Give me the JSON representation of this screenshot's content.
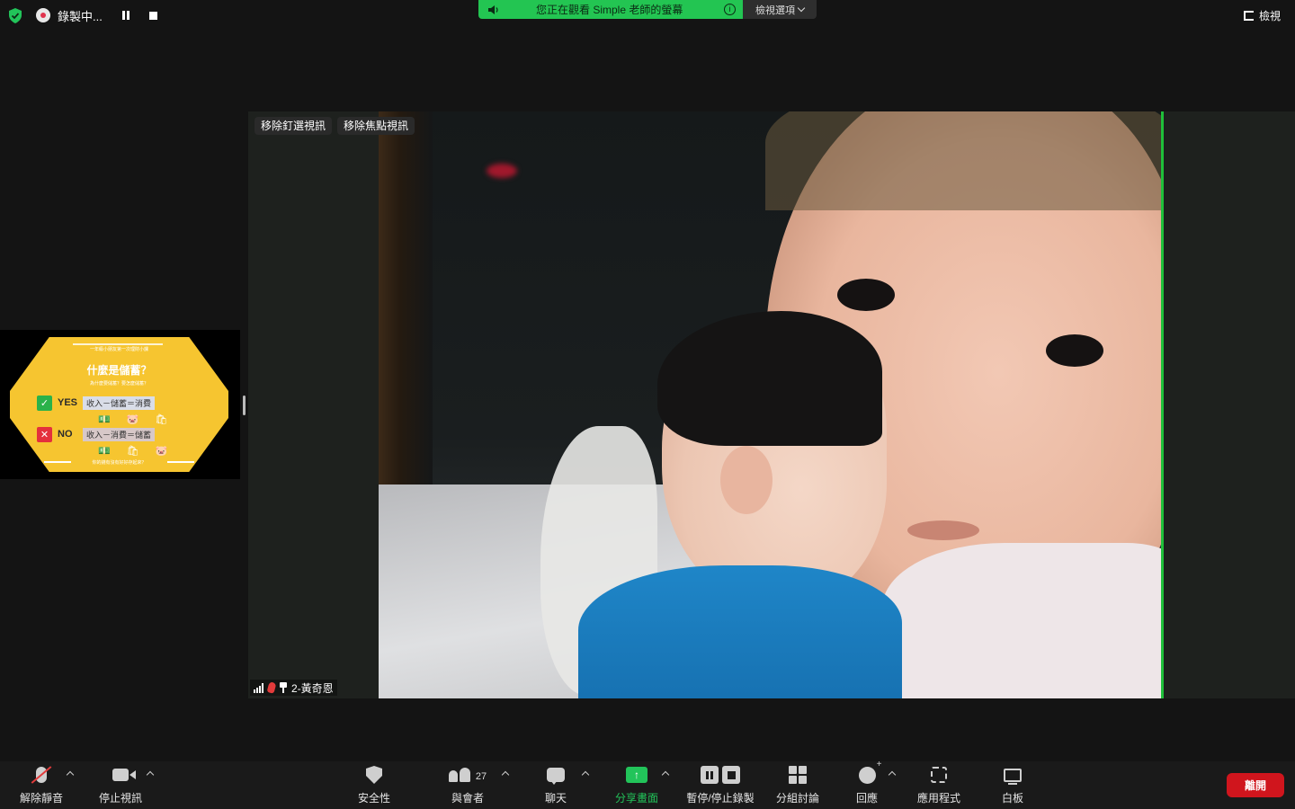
{
  "topbar": {
    "recording_label": "錄製中...",
    "share_banner_text": "您正在觀看 Simple 老師的螢幕",
    "view_options_label": "檢視選項",
    "view_label": "檢視",
    "colors": {
      "banner": "#23c552",
      "shield": "#22c45a"
    }
  },
  "stage": {
    "remove_pin_label": "移除釘選視訊",
    "remove_spotlight_label": "移除焦點視訊",
    "participant_name": "2-黃奇恩"
  },
  "thumbnail": {
    "header": "一年級小朋友第一次理財小課",
    "question": "什麼是儲蓄？",
    "subtitle": "為什麼要儲蓄？要怎麼儲蓄？",
    "yes_label": "YES",
    "yes_formula": "收入－儲蓄＝消費",
    "no_label": "NO",
    "no_formula": "收入－消費＝儲蓄",
    "footer": "你的錢有沒有好好存起來？"
  },
  "toolbar": {
    "unmute": "解除靜音",
    "stop_video": "停止視訊",
    "security": "安全性",
    "participants": "與會者",
    "participants_count": "27",
    "chat": "聊天",
    "share_screen": "分享畫面",
    "pause_stop_recording": "暫停/停止錄製",
    "breakout_rooms": "分組討論",
    "reactions": "回應",
    "apps": "應用程式",
    "whiteboard": "白板",
    "leave": "離開"
  }
}
